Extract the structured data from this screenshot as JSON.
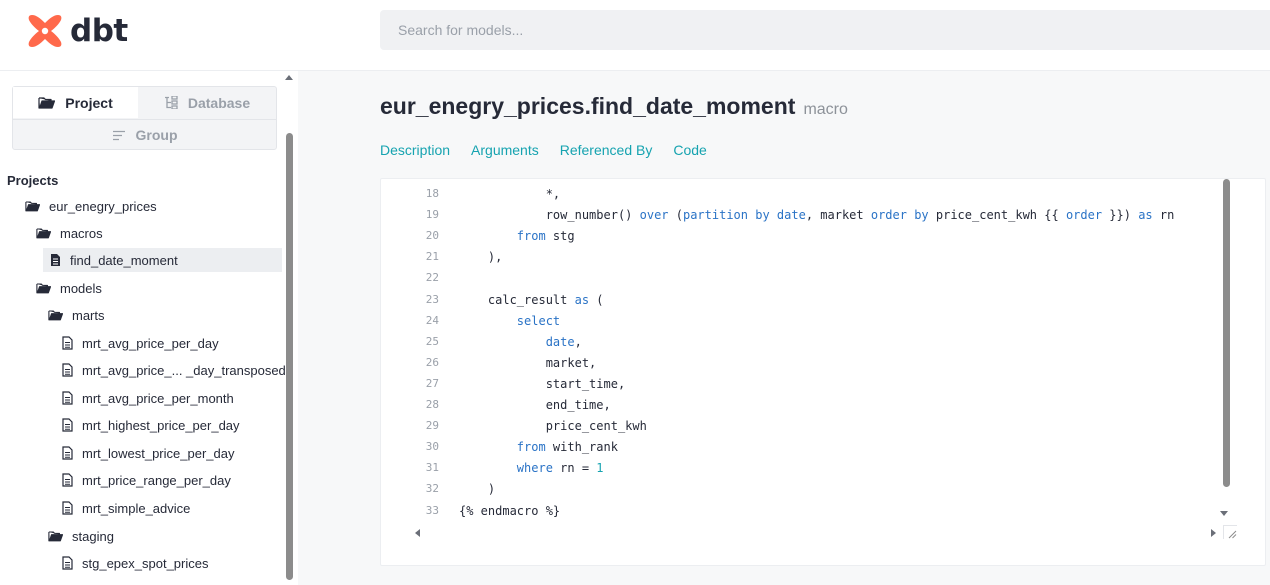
{
  "header": {
    "logo_text": "dbt",
    "search_placeholder": "Search for models..."
  },
  "sidebar": {
    "switcher": {
      "project": "Project",
      "database": "Database",
      "group": "Group",
      "active": "Project"
    },
    "tree_heading": "Projects",
    "tree": [
      {
        "label": "eur_enegry_prices",
        "type": "folder"
      },
      {
        "label": "macros",
        "type": "folder"
      },
      {
        "label": "find_date_moment",
        "type": "file",
        "selected": true
      },
      {
        "label": "models",
        "type": "folder"
      },
      {
        "label": "marts",
        "type": "folder"
      },
      {
        "label": "mrt_avg_price_per_day",
        "type": "file"
      },
      {
        "label": "mrt_avg_price_... _day_transposed",
        "type": "file"
      },
      {
        "label": "mrt_avg_price_per_month",
        "type": "file"
      },
      {
        "label": "mrt_highest_price_per_day",
        "type": "file"
      },
      {
        "label": "mrt_lowest_price_per_day",
        "type": "file"
      },
      {
        "label": "mrt_price_range_per_day",
        "type": "file"
      },
      {
        "label": "mrt_simple_advice",
        "type": "file"
      },
      {
        "label": "staging",
        "type": "folder"
      },
      {
        "label": "stg_epex_spot_prices",
        "type": "file"
      }
    ]
  },
  "main": {
    "title": "eur_enegry_prices.find_date_moment",
    "subtitle": "macro",
    "tabs": [
      "Description",
      "Arguments",
      "Referenced By",
      "Code"
    ]
  },
  "code": {
    "lines": [
      {
        "n": "18",
        "segs": [
          {
            "t": "            *,"
          }
        ]
      },
      {
        "n": "19",
        "segs": [
          {
            "t": "            row_number() "
          },
          {
            "t": "over",
            "c": "kw"
          },
          {
            "t": " ("
          },
          {
            "t": "partition by",
            "c": "kw"
          },
          {
            "t": " "
          },
          {
            "t": "date",
            "c": "kw"
          },
          {
            "t": ", market "
          },
          {
            "t": "order by",
            "c": "kw"
          },
          {
            "t": " price_cent_kwh {{ "
          },
          {
            "t": "order",
            "c": "kw"
          },
          {
            "t": " }}) "
          },
          {
            "t": "as",
            "c": "kw"
          },
          {
            "t": " rn"
          }
        ]
      },
      {
        "n": "20",
        "segs": [
          {
            "t": "        "
          },
          {
            "t": "from",
            "c": "kw"
          },
          {
            "t": " stg"
          }
        ]
      },
      {
        "n": "21",
        "segs": [
          {
            "t": "    ),"
          }
        ]
      },
      {
        "n": "22",
        "segs": [
          {
            "t": ""
          }
        ]
      },
      {
        "n": "23",
        "segs": [
          {
            "t": "    calc_result "
          },
          {
            "t": "as",
            "c": "kw"
          },
          {
            "t": " ("
          }
        ]
      },
      {
        "n": "24",
        "segs": [
          {
            "t": "        "
          },
          {
            "t": "select",
            "c": "kw"
          }
        ]
      },
      {
        "n": "25",
        "segs": [
          {
            "t": "            "
          },
          {
            "t": "date",
            "c": "kw"
          },
          {
            "t": ","
          }
        ]
      },
      {
        "n": "26",
        "segs": [
          {
            "t": "            market,"
          }
        ]
      },
      {
        "n": "27",
        "segs": [
          {
            "t": "            start_time,"
          }
        ]
      },
      {
        "n": "28",
        "segs": [
          {
            "t": "            end_time,"
          }
        ]
      },
      {
        "n": "29",
        "segs": [
          {
            "t": "            price_cent_kwh"
          }
        ]
      },
      {
        "n": "30",
        "segs": [
          {
            "t": "        "
          },
          {
            "t": "from",
            "c": "kw"
          },
          {
            "t": " with_rank"
          }
        ]
      },
      {
        "n": "31",
        "segs": [
          {
            "t": "        "
          },
          {
            "t": "where",
            "c": "kw"
          },
          {
            "t": " rn = "
          },
          {
            "t": "1",
            "c": "num"
          }
        ]
      },
      {
        "n": "32",
        "segs": [
          {
            "t": "    )"
          }
        ]
      },
      {
        "n": "33",
        "segs": [
          {
            "t": "{% endmacro %}"
          }
        ]
      }
    ]
  },
  "icons": {
    "folder": "folder-open-icon",
    "file": "document-icon",
    "database": "database-tree-icon",
    "group": "group-lines-icon"
  },
  "colors": {
    "brand": "#ff694b",
    "accent": "#16a3b0",
    "keyword": "#2a73c6"
  }
}
